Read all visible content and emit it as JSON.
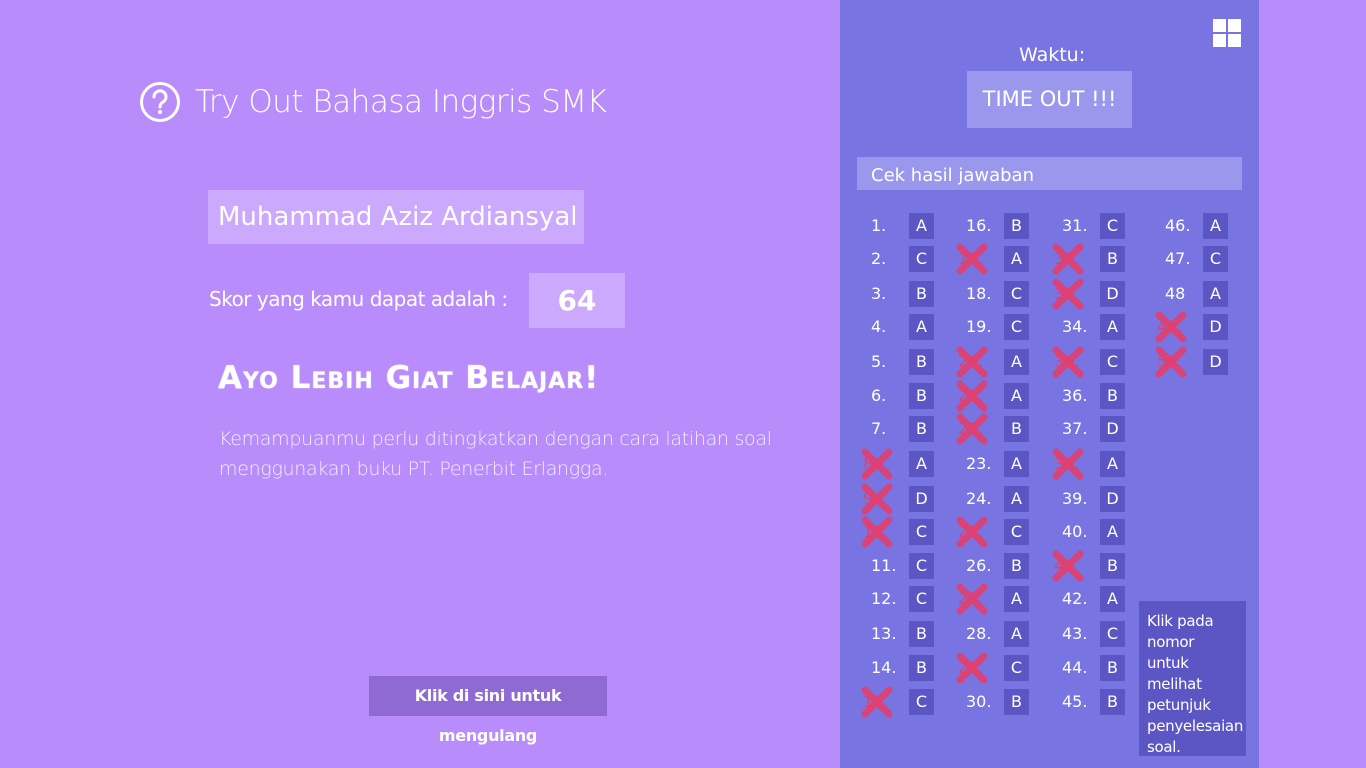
{
  "app": {
    "title": "Try Out Bahasa Inggris SMK",
    "icon": "help-circle-icon"
  },
  "result": {
    "student_name": "Muhammad Aziz Ardiansyal",
    "score_label": "Skor yang kamu dapat adalah :",
    "score": "64",
    "motivation": "Ayo Lebih Giat Belajar!",
    "advice": "Kemampuanmu perlu ditingkatkan dengan cara latihan soal menggunakan buku PT. Penerbit Erlangga.",
    "retry_button": "Klik di sini untuk mengulang"
  },
  "panel": {
    "timer_label": "Waktu:",
    "timer_value": "TIME OUT !!!",
    "check_header": "Cek hasil jawaban",
    "hint": "Klik pada nomor untuk melihat petunjuk penyelesaian soal.",
    "wrong_color": "#e23f6f"
  },
  "answers": [
    {
      "num": "1.",
      "ans": "A",
      "wrong": false
    },
    {
      "num": "2.",
      "ans": "C",
      "wrong": false
    },
    {
      "num": "3.",
      "ans": "B",
      "wrong": false
    },
    {
      "num": "4.",
      "ans": "A",
      "wrong": false
    },
    {
      "num": "5.",
      "ans": "B",
      "wrong": false
    },
    {
      "num": "6.",
      "ans": "B",
      "wrong": false
    },
    {
      "num": "7.",
      "ans": "B",
      "wrong": false
    },
    {
      "num": "8.",
      "ans": "A",
      "wrong": true
    },
    {
      "num": "9.",
      "ans": "D",
      "wrong": true
    },
    {
      "num": "10.",
      "ans": "C",
      "wrong": true
    },
    {
      "num": "11.",
      "ans": "C",
      "wrong": false
    },
    {
      "num": "12.",
      "ans": "C",
      "wrong": false
    },
    {
      "num": "13.",
      "ans": "B",
      "wrong": false
    },
    {
      "num": "14.",
      "ans": "B",
      "wrong": false
    },
    {
      "num": "15.",
      "ans": "C",
      "wrong": true
    },
    {
      "num": "16.",
      "ans": "B",
      "wrong": false
    },
    {
      "num": "17.",
      "ans": "A",
      "wrong": true
    },
    {
      "num": "18.",
      "ans": "C",
      "wrong": false
    },
    {
      "num": "19.",
      "ans": "C",
      "wrong": false
    },
    {
      "num": "20.",
      "ans": "A",
      "wrong": true
    },
    {
      "num": "21.",
      "ans": "A",
      "wrong": true
    },
    {
      "num": "22.",
      "ans": "B",
      "wrong": true
    },
    {
      "num": "23.",
      "ans": "A",
      "wrong": false
    },
    {
      "num": "24.",
      "ans": "A",
      "wrong": false
    },
    {
      "num": "25.",
      "ans": "C",
      "wrong": true
    },
    {
      "num": "26.",
      "ans": "B",
      "wrong": false
    },
    {
      "num": "27.",
      "ans": "A",
      "wrong": true
    },
    {
      "num": "28.",
      "ans": "A",
      "wrong": false
    },
    {
      "num": "29.",
      "ans": "C",
      "wrong": true
    },
    {
      "num": "30.",
      "ans": "B",
      "wrong": false
    },
    {
      "num": "31.",
      "ans": "C",
      "wrong": false
    },
    {
      "num": "32.",
      "ans": "B",
      "wrong": true
    },
    {
      "num": "33.",
      "ans": "D",
      "wrong": true
    },
    {
      "num": "34.",
      "ans": "A",
      "wrong": false
    },
    {
      "num": "35.",
      "ans": "C",
      "wrong": true
    },
    {
      "num": "36.",
      "ans": "B",
      "wrong": false
    },
    {
      "num": "37.",
      "ans": "D",
      "wrong": false
    },
    {
      "num": "38.",
      "ans": "A",
      "wrong": true
    },
    {
      "num": "39.",
      "ans": "D",
      "wrong": false
    },
    {
      "num": "40.",
      "ans": "A",
      "wrong": false
    },
    {
      "num": "41.",
      "ans": "B",
      "wrong": true
    },
    {
      "num": "42.",
      "ans": "A",
      "wrong": false
    },
    {
      "num": "43.",
      "ans": "C",
      "wrong": false
    },
    {
      "num": "44.",
      "ans": "B",
      "wrong": false
    },
    {
      "num": "45.",
      "ans": "B",
      "wrong": false
    },
    {
      "num": "46.",
      "ans": "A",
      "wrong": false
    },
    {
      "num": "47.",
      "ans": "C",
      "wrong": false
    },
    {
      "num": "48",
      "ans": "A",
      "wrong": false
    },
    {
      "num": "49.",
      "ans": "D",
      "wrong": true
    },
    {
      "num": "50.",
      "ans": "D",
      "wrong": true
    }
  ]
}
